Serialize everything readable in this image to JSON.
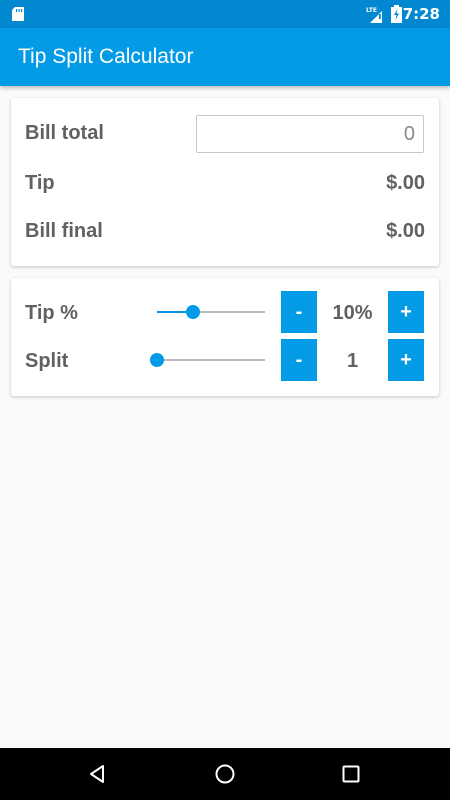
{
  "status_bar": {
    "time": "7:28",
    "icons": [
      "sd-card-icon",
      "lte-signal-icon",
      "battery-charging-icon"
    ]
  },
  "app_bar": {
    "title": "Tip Split Calculator"
  },
  "bill_card": {
    "bill_total_label": "Bill total",
    "bill_total_value": "0",
    "tip_label": "Tip",
    "tip_value": "$.00",
    "bill_final_label": "Bill final",
    "bill_final_value": "$.00"
  },
  "controls_card": {
    "tip_percent": {
      "label": "Tip %",
      "display_value": "10%",
      "slider_level": 0.33,
      "minus_label": "-",
      "plus_label": "+"
    },
    "split": {
      "label": "Split",
      "display_value": "1",
      "slider_level": 0.0,
      "minus_label": "-",
      "plus_label": "+"
    }
  },
  "nav_bar": {
    "icons": [
      "back-icon",
      "home-icon",
      "recents-icon"
    ]
  },
  "colors": {
    "status_bar": "#0288d1",
    "app_bar": "#039be5",
    "accent": "#039be5",
    "text": "#616161",
    "background": "#fafafa"
  }
}
